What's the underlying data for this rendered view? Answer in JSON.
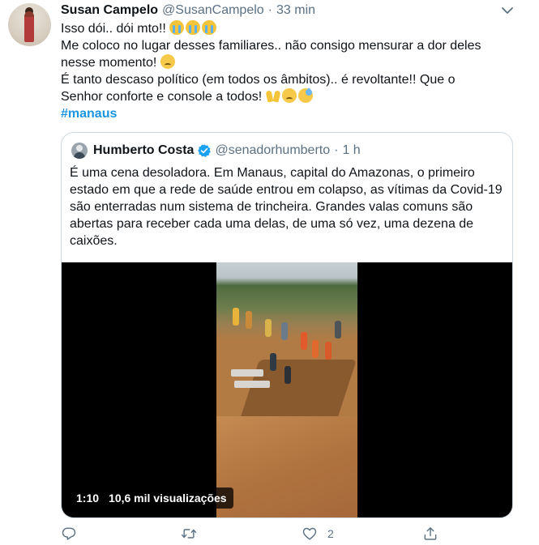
{
  "tweet": {
    "author_name": "Susan Campelo",
    "author_handle": "@SusanCampelo",
    "separator": "·",
    "time": "33 min",
    "lines": [
      "Isso dói.. dói mto!!",
      "Me coloco no lugar desses familiares.. não consigo mensurar a dor deles",
      "nesse momento!",
      "É tanto descaso político (em todos os âmbitos).. é revoltante!! Que o",
      "Senhor conforte e console a todos!"
    ],
    "hashtag": "#manaus"
  },
  "quoted": {
    "author_name": "Humberto Costa",
    "author_handle": "@senadorhumberto",
    "separator": "·",
    "time": "1 h",
    "text": "É uma cena desoladora. Em Manaus, capital do Amazonas, o primeiro estado em que a rede de saúde entrou em colapso, as vítimas da Covid-19 são enterradas num sistema de trincheira. Grandes valas comuns são abertas para receber cada uma delas, de uma só vez, uma dezena de caixões.",
    "video": {
      "duration": "1:10",
      "views": "10,6 mil visualizações"
    }
  },
  "actions": {
    "reply_icon": "reply-icon",
    "retweet_icon": "retweet-icon",
    "like_icon": "like-icon",
    "like_count": "2",
    "share_icon": "share-icon"
  },
  "colors": {
    "text": "#0f1419",
    "secondary": "#5b7083",
    "link": "#1b95e0",
    "border": "#cfd9de",
    "verified": "#1da1f2"
  }
}
